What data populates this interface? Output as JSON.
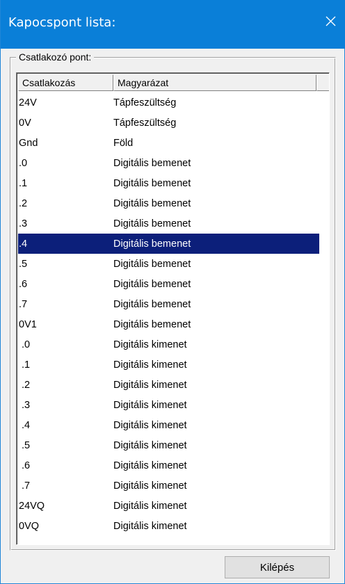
{
  "window": {
    "title": "Kapocspont lista:"
  },
  "group": {
    "label": "Csatlakozó pont:"
  },
  "columns": {
    "connection": "Csatlakozás",
    "description": "Magyarázat"
  },
  "rows": [
    {
      "c": "24V",
      "d": "Tápfeszültség"
    },
    {
      "c": "0V",
      "d": "Tápfeszültség"
    },
    {
      "c": "Gnd",
      "d": "Föld"
    },
    {
      "c": ".0",
      "d": "Digitális bemenet"
    },
    {
      "c": ".1",
      "d": "Digitális bemenet"
    },
    {
      "c": ".2",
      "d": "Digitális bemenet"
    },
    {
      "c": ".3",
      "d": "Digitális bemenet"
    },
    {
      "c": ".4",
      "d": "Digitális bemenet"
    },
    {
      "c": ".5",
      "d": "Digitális bemenet"
    },
    {
      "c": ".6",
      "d": "Digitális bemenet"
    },
    {
      "c": ".7",
      "d": "Digitális bemenet"
    },
    {
      "c": "0V1",
      "d": "Digitális bemenet"
    },
    {
      "c": " .0",
      "d": "Digitális kimenet"
    },
    {
      "c": " .1",
      "d": "Digitális kimenet"
    },
    {
      "c": " .2",
      "d": "Digitális kimenet"
    },
    {
      "c": " .3",
      "d": "Digitális kimenet"
    },
    {
      "c": " .4",
      "d": "Digitális kimenet"
    },
    {
      "c": " .5",
      "d": "Digitális kimenet"
    },
    {
      "c": " .6",
      "d": "Digitális kimenet"
    },
    {
      "c": " .7",
      "d": "Digitális kimenet"
    },
    {
      "c": "24VQ",
      "d": "Digitális kimenet"
    },
    {
      "c": "0VQ",
      "d": "Digitális kimenet"
    }
  ],
  "selected_row": 7,
  "buttons": {
    "exit": "Kilépés"
  },
  "icons": {
    "close": "close-icon"
  },
  "colors": {
    "titlebar": "#0a7fd8",
    "selection": "#0c1f7a"
  }
}
